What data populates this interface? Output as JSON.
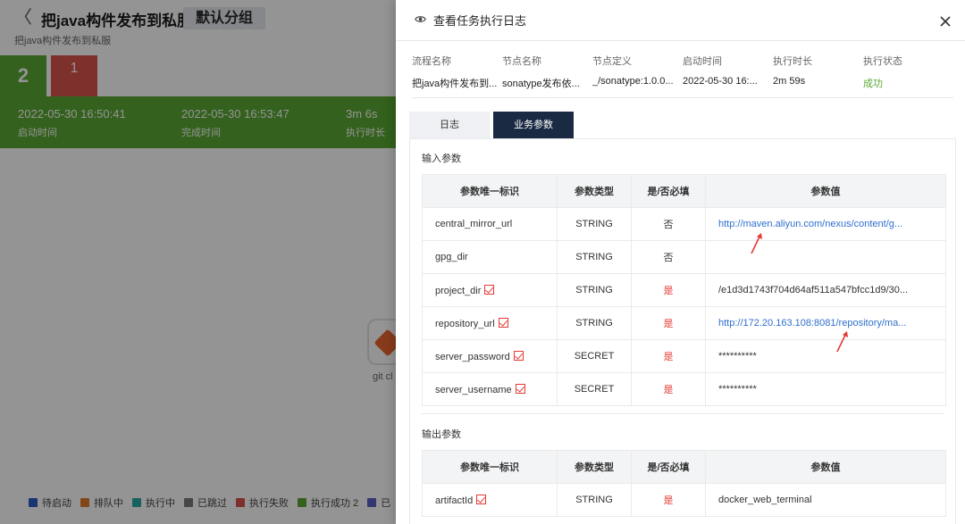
{
  "background": {
    "back_glyph": "〈",
    "title": "把java构件发布到私服",
    "group_label": "默认分组",
    "subtitle": "把java构件发布到私服",
    "run_tabs": [
      {
        "number": "2",
        "status_color": "#5aa833"
      },
      {
        "number": "1",
        "status_color": "#d9534f"
      }
    ],
    "summary": [
      {
        "value": "2022-05-30 16:50:41",
        "label": "启动时间"
      },
      {
        "value": "2022-05-30 16:53:47",
        "label": "完成时间"
      },
      {
        "value": "3m 6s",
        "label": "执行时长"
      }
    ],
    "node_label": "git cl",
    "legend": [
      {
        "label": "待启动",
        "color": "#2b5cc4"
      },
      {
        "label": "排队中",
        "color": "#e07b2c"
      },
      {
        "label": "执行中",
        "color": "#2aa7a7"
      },
      {
        "label": "已跳过",
        "color": "#7a7a7a"
      },
      {
        "label": "执行失败",
        "color": "#d9534f"
      },
      {
        "label": "执行成功 2",
        "color": "#5aa833"
      },
      {
        "label": "已",
        "color": "#5b5fc7"
      }
    ]
  },
  "drawer": {
    "title": "查看任务执行日志",
    "icon": "eye-icon",
    "close_icon": "close-icon",
    "info": [
      {
        "key": "流程名称",
        "value": "把java构件发布到..."
      },
      {
        "key": "节点名称",
        "value": "sonatype发布依..."
      },
      {
        "key": "节点定义",
        "value": "_/sonatype:1.0.0..."
      },
      {
        "key": "启动时间",
        "value": "2022-05-30 16:..."
      },
      {
        "key": "执行时长",
        "value": "2m 59s"
      },
      {
        "key": "执行状态",
        "value": "成功"
      }
    ],
    "tabs": [
      {
        "label": "日志",
        "active": false
      },
      {
        "label": "业务参数",
        "active": true
      }
    ],
    "input_section": {
      "title": "输入参数",
      "headers": [
        "参数唯一标识",
        "参数类型",
        "是/否必填",
        "参数值"
      ],
      "rows": [
        {
          "key": "central_mirror_url",
          "required_mark": false,
          "type": "STRING",
          "required": "否",
          "value": "http://maven.aliyun.com/nexus/content/g...",
          "is_link": true
        },
        {
          "key": "gpg_dir",
          "required_mark": false,
          "type": "STRING",
          "required": "否",
          "value": "",
          "is_link": false
        },
        {
          "key": "project_dir",
          "required_mark": true,
          "type": "STRING",
          "required": "是",
          "value": "/e1d3d1743f704d64af511a547bfcc1d9/30...",
          "is_link": false
        },
        {
          "key": "repository_url",
          "required_mark": true,
          "type": "STRING",
          "required": "是",
          "value": "http://172.20.163.108:8081/repository/ma...",
          "is_link": true
        },
        {
          "key": "server_password",
          "required_mark": true,
          "type": "SECRET",
          "required": "是",
          "value": "**********",
          "is_link": false
        },
        {
          "key": "server_username",
          "required_mark": true,
          "type": "SECRET",
          "required": "是",
          "value": "**********",
          "is_link": false
        }
      ]
    },
    "output_section": {
      "title": "输出参数",
      "headers": [
        "参数唯一标识",
        "参数类型",
        "是/否必填",
        "参数值"
      ],
      "rows": [
        {
          "key": "artifactId",
          "required_mark": true,
          "type": "STRING",
          "required": "是",
          "value": "docker_web_terminal",
          "is_link": false
        }
      ]
    }
  }
}
